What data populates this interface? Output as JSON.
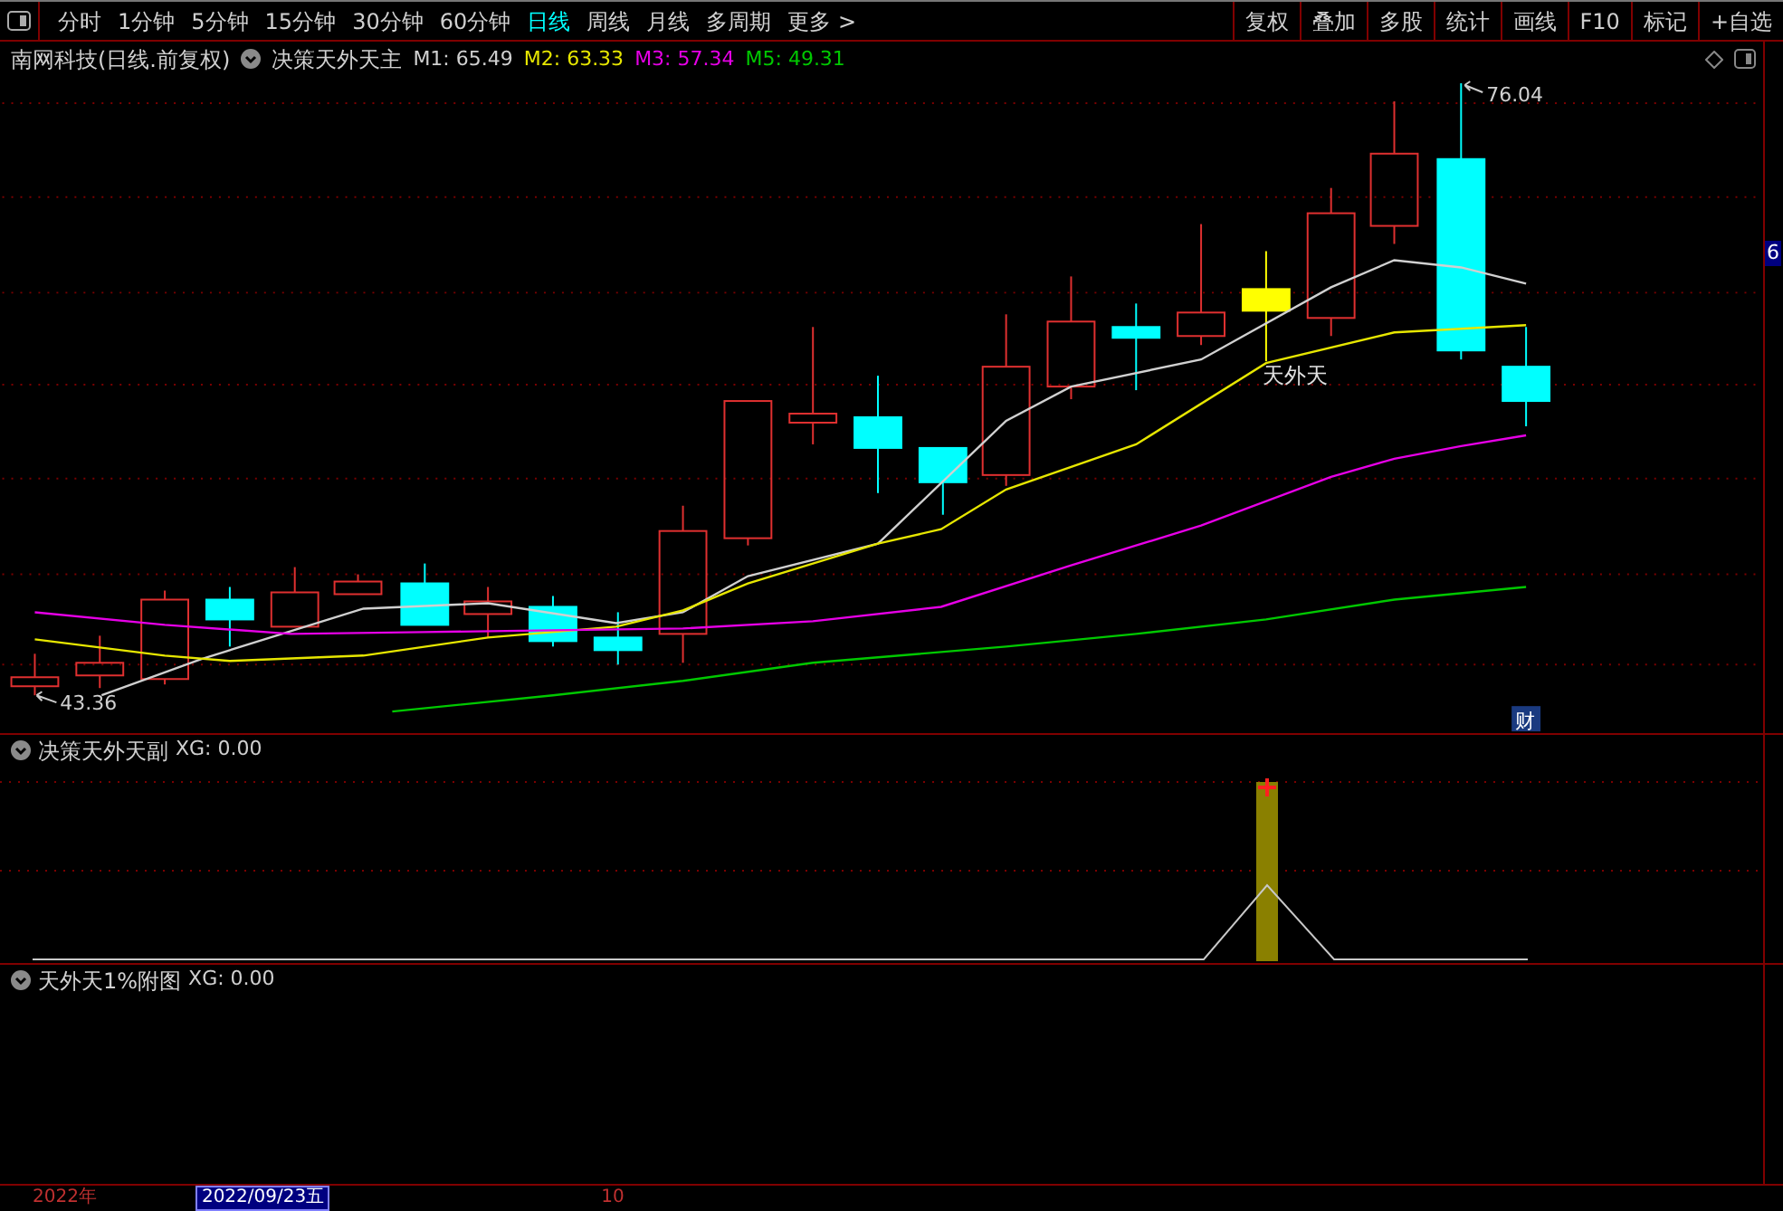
{
  "toolbar": {
    "periods": [
      {
        "label": "分时",
        "selected": false
      },
      {
        "label": "1分钟",
        "selected": false
      },
      {
        "label": "5分钟",
        "selected": false
      },
      {
        "label": "15分钟",
        "selected": false
      },
      {
        "label": "30分钟",
        "selected": false
      },
      {
        "label": "60分钟",
        "selected": false
      },
      {
        "label": "日线",
        "selected": true
      },
      {
        "label": "周线",
        "selected": false
      },
      {
        "label": "月线",
        "selected": false
      },
      {
        "label": "多周期",
        "selected": false
      }
    ],
    "more": "更多 >",
    "actions": [
      "复权",
      "叠加",
      "多股",
      "统计",
      "画线",
      "F10",
      "标记",
      "+自选"
    ]
  },
  "main_chart": {
    "stock_label": "南网科技(日线.前复权)",
    "indicator": "决策天外天主",
    "moving_averages": [
      {
        "label": "M1: 65.49",
        "color": "#d0d0d0"
      },
      {
        "label": "M2: 63.33",
        "color": "#e6e600"
      },
      {
        "label": "M3: 57.34",
        "color": "#e600e6"
      },
      {
        "label": "M5: 49.31",
        "color": "#00c800"
      }
    ],
    "high_label": "76.04",
    "low_label": "43.36",
    "signal_label": "天外天",
    "finance_badge": "财",
    "price_tag": "6"
  },
  "sub_chart_1": {
    "indicator": "决策天外天副",
    "reading": "XG: 0.00"
  },
  "sub_chart_2": {
    "indicator": "天外天1%附图",
    "reading": "XG: 0.00"
  },
  "date_axis": [
    {
      "label": "2022年",
      "selected": false
    },
    {
      "label": "2022/09/23五",
      "selected": true
    },
    {
      "label": "10",
      "selected": false
    }
  ]
}
